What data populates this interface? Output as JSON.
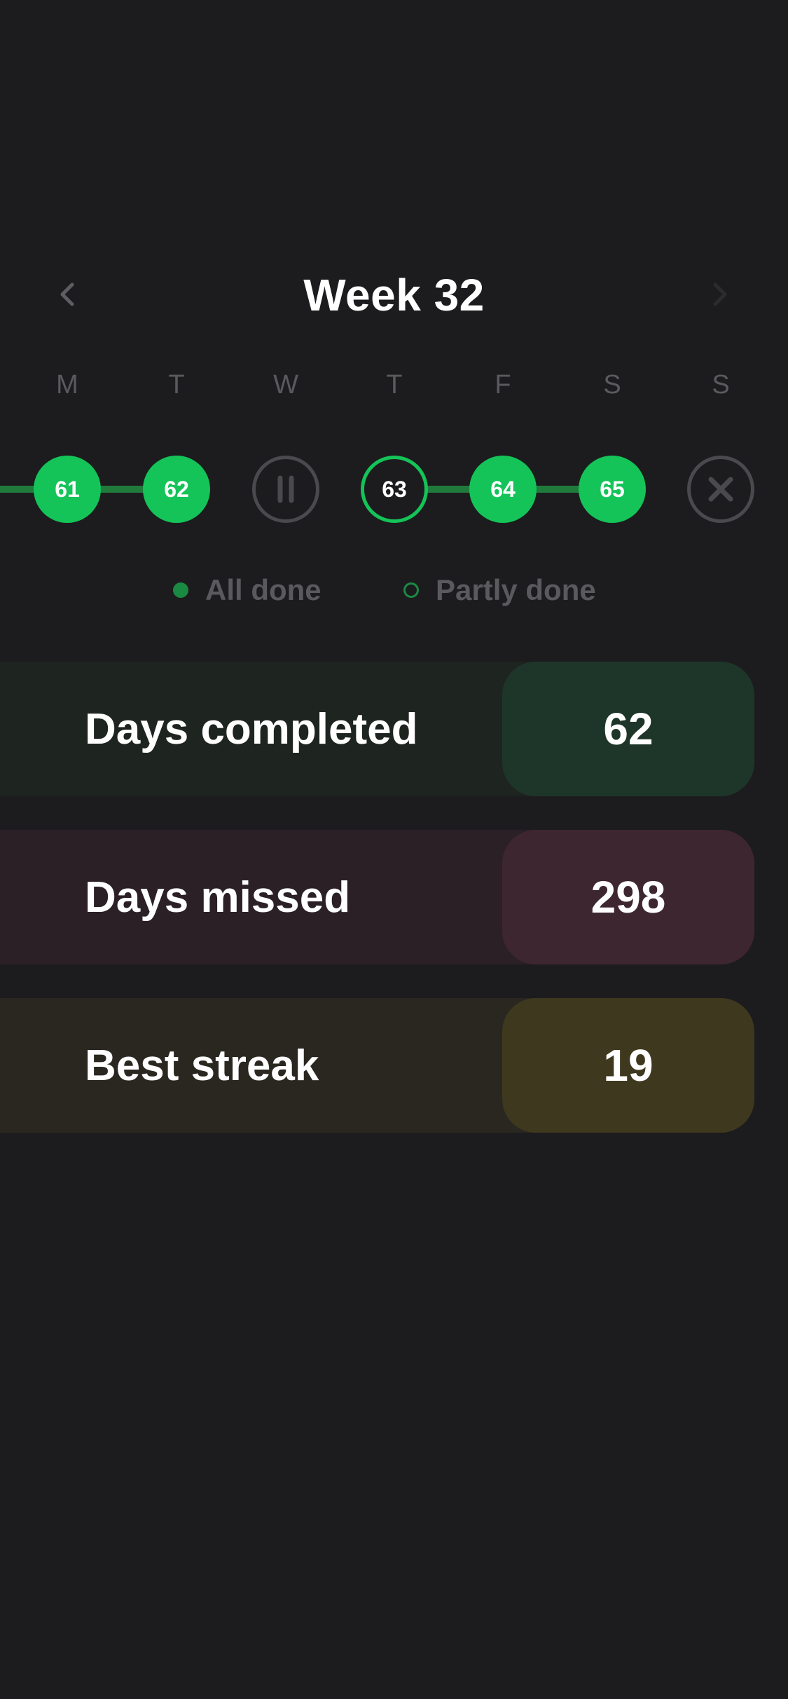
{
  "header": {
    "title": "Week 32",
    "prev_icon": "chevron-left-icon",
    "next_icon": "chevron-right-icon"
  },
  "weekdays": [
    "M",
    "T",
    "W",
    "T",
    "F",
    "S",
    "S"
  ],
  "days": [
    {
      "label": "61",
      "status": "done"
    },
    {
      "label": "62",
      "status": "done"
    },
    {
      "label": "",
      "status": "paused",
      "icon": "pause-icon"
    },
    {
      "label": "63",
      "status": "partial"
    },
    {
      "label": "64",
      "status": "done"
    },
    {
      "label": "65",
      "status": "done"
    },
    {
      "label": "",
      "status": "missed",
      "icon": "close-icon"
    }
  ],
  "legend": {
    "all_done": "All done",
    "partly_done": "Partly done"
  },
  "stats": [
    {
      "label": "Days completed",
      "value": "62",
      "bg": "#1e2420",
      "accent": "#1e3629"
    },
    {
      "label": "Days missed",
      "value": "298",
      "bg": "#2a2026",
      "accent": "#3e2631"
    },
    {
      "label": "Best streak",
      "value": "19",
      "bg": "#2a2721",
      "accent": "#3e381e"
    }
  ],
  "colors": {
    "background": "#1c1c1e",
    "done_green": "#14c458",
    "connector_green": "#1f7a3c",
    "muted_text": "#5a5a5e",
    "inactive_ring": "#4a4a4e"
  }
}
